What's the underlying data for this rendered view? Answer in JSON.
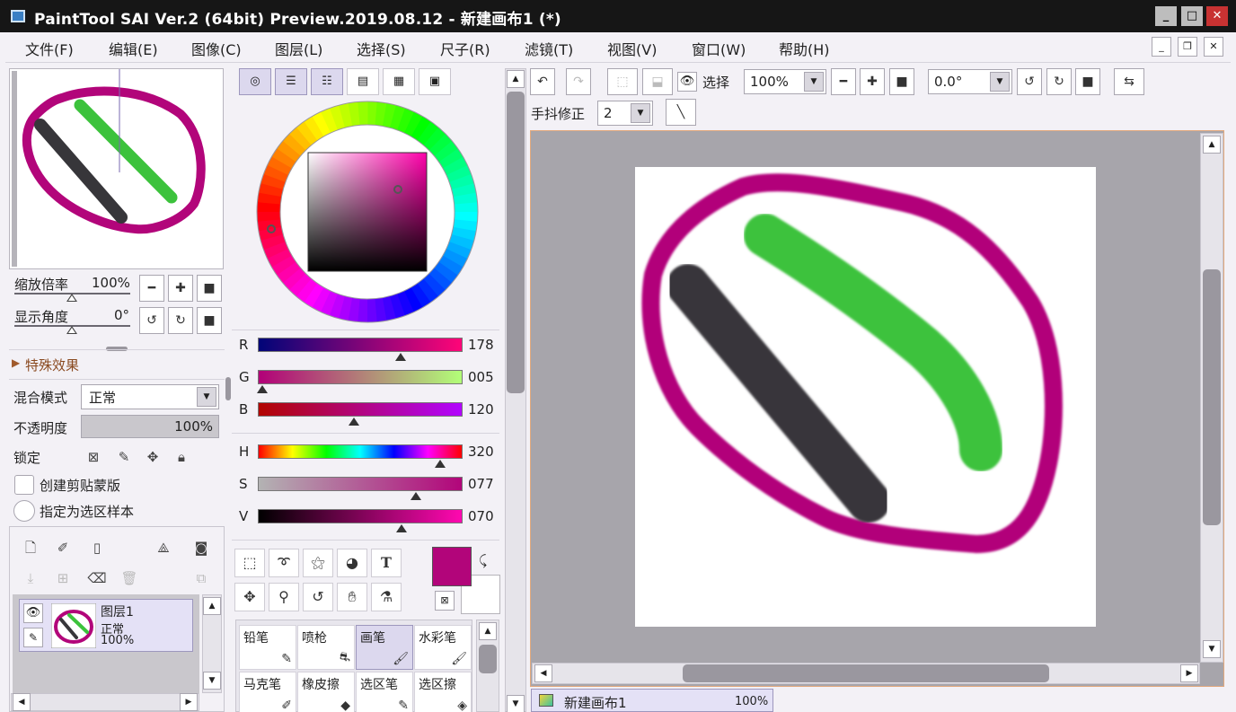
{
  "window": {
    "title": "PaintTool SAI Ver.2 (64bit) Preview.2019.08.12 - 新建画布1 (*)",
    "controls": {
      "minimize": "_",
      "maximize": "□",
      "close": "✕"
    }
  },
  "menu": {
    "items": [
      "文件(F)",
      "编辑(E)",
      "图像(C)",
      "图层(L)",
      "选择(S)",
      "尺子(R)",
      "滤镜(T)",
      "视图(V)",
      "窗口(W)",
      "帮助(H)"
    ],
    "mdi": {
      "minimize": "_",
      "restore": "❐",
      "close": "✕"
    }
  },
  "navigator": {
    "zoom_label": "缩放倍率",
    "zoom_value": "100%",
    "angle_label": "显示角度",
    "angle_value": "0°"
  },
  "layer_props": {
    "effects_label": "特殊效果",
    "blend_label": "混合模式",
    "blend_value": "正常",
    "opacity_label": "不透明度",
    "opacity_value": "100%",
    "opacity_fraction": 1.0,
    "lock_label": "锁定",
    "clip_label": "创建剪贴蒙版",
    "selection_source_label": "指定为选区样本"
  },
  "layers": [
    {
      "name": "图层1",
      "mode": "正常",
      "opacity": "100%"
    }
  ],
  "color": {
    "current_hex": "#b2057a",
    "rgb": {
      "labels": [
        "R",
        "G",
        "B"
      ],
      "values": [
        "178",
        "005",
        "120"
      ],
      "fractions": [
        0.698,
        0.02,
        0.47
      ]
    },
    "hsv": {
      "labels": [
        "H",
        "S",
        "V"
      ],
      "values": [
        "320",
        "077",
        "070"
      ],
      "fractions": [
        0.889,
        0.77,
        0.7
      ]
    }
  },
  "brushes": [
    {
      "name": "铅笔",
      "icon": "pencil-icon"
    },
    {
      "name": "喷枪",
      "icon": "airbrush-icon"
    },
    {
      "name": "画笔",
      "icon": "brush-icon",
      "active": true
    },
    {
      "name": "水彩笔",
      "icon": "watercolor-icon"
    },
    {
      "name": "马克笔",
      "icon": "marker-icon"
    },
    {
      "name": "橡皮擦",
      "icon": "eraser-icon"
    },
    {
      "name": "选区笔",
      "icon": "selpen-icon"
    },
    {
      "name": "选区擦",
      "icon": "selerase-icon"
    }
  ],
  "toolbar": {
    "select_label": "选择",
    "zoom_value": "100%",
    "rotation_value": "0.0°",
    "stabilizer_label": "手抖修正",
    "stabilizer_value": "2"
  },
  "canvas_tab": {
    "name": "新建画布1",
    "zoom": "100%"
  },
  "colors": {
    "magenta": "#b2057a",
    "green": "#3cc23c",
    "dark": "#37363a",
    "accent": "#e2a97e"
  }
}
